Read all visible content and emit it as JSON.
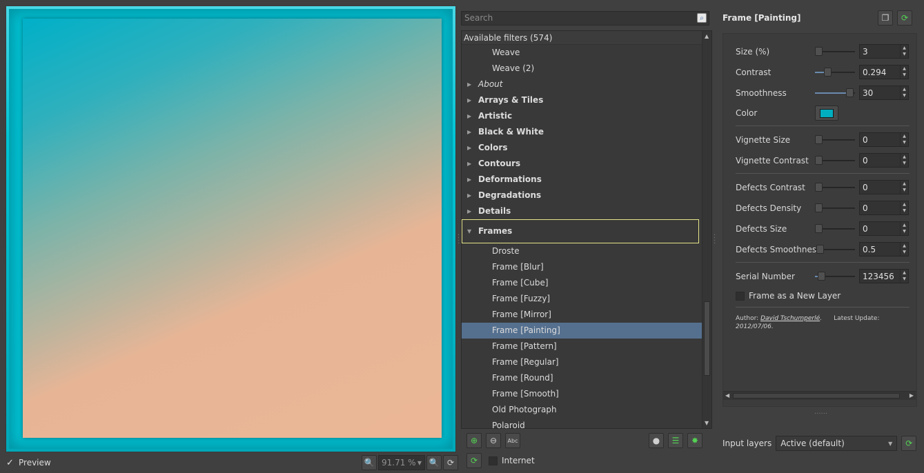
{
  "preview": {
    "checkbox_label": "Preview",
    "checked": true,
    "zoom": "91.71 %"
  },
  "search": {
    "placeholder": "Search"
  },
  "filter_tree": {
    "header": "Available filters (574)",
    "rows": [
      {
        "label": "Weave",
        "kind": "leaf"
      },
      {
        "label": "Weave (2)",
        "kind": "leaf"
      },
      {
        "label": "About",
        "kind": "category-italic"
      },
      {
        "label": "Arrays & Tiles",
        "kind": "category"
      },
      {
        "label": "Artistic",
        "kind": "category"
      },
      {
        "label": "Black & White",
        "kind": "category"
      },
      {
        "label": "Colors",
        "kind": "category"
      },
      {
        "label": "Contours",
        "kind": "category"
      },
      {
        "label": "Deformations",
        "kind": "category"
      },
      {
        "label": "Degradations",
        "kind": "category"
      },
      {
        "label": "Details",
        "kind": "category"
      },
      {
        "label": "Frames",
        "kind": "category-open"
      },
      {
        "label": "Droste",
        "kind": "leaf"
      },
      {
        "label": "Frame [Blur]",
        "kind": "leaf"
      },
      {
        "label": "Frame [Cube]",
        "kind": "leaf"
      },
      {
        "label": "Frame [Fuzzy]",
        "kind": "leaf"
      },
      {
        "label": "Frame [Mirror]",
        "kind": "leaf"
      },
      {
        "label": "Frame [Painting]",
        "kind": "leaf-selected"
      },
      {
        "label": "Frame [Pattern]",
        "kind": "leaf"
      },
      {
        "label": "Frame [Regular]",
        "kind": "leaf"
      },
      {
        "label": "Frame [Round]",
        "kind": "leaf"
      },
      {
        "label": "Frame [Smooth]",
        "kind": "leaf"
      },
      {
        "label": "Old Photograph",
        "kind": "leaf"
      },
      {
        "label": "Polaroid",
        "kind": "leaf"
      }
    ]
  },
  "internet": {
    "label": "Internet",
    "checked": false
  },
  "params": {
    "title": "Frame [Painting]",
    "size_label": "Size (%)",
    "size_value": "3",
    "contrast_label": "Contrast",
    "contrast_value": "0.294",
    "smoothness_label": "Smoothness",
    "smoothness_value": "30",
    "color_label": "Color",
    "color_hex": "#00aec0",
    "vignette_size_label": "Vignette Size",
    "vignette_size_value": "0",
    "vignette_contrast_label": "Vignette Contrast",
    "vignette_contrast_value": "0",
    "defects_contrast_label": "Defects Contrast",
    "defects_contrast_value": "0",
    "defects_density_label": "Defects Density",
    "defects_density_value": "0",
    "defects_size_label": "Defects Size",
    "defects_size_value": "0",
    "defects_smoothness_label": "Defects Smoothness",
    "defects_smoothness_value": "0.5",
    "serial_label": "Serial Number",
    "serial_value": "123456",
    "new_layer_label": "Frame as a New Layer",
    "author_prefix": "Author:",
    "author_name": "David Tschumperlé",
    "update_prefix": "Latest Update:",
    "update_date": "2012/07/06."
  },
  "input_layers": {
    "label": "Input layers",
    "value": "Active (default)"
  }
}
